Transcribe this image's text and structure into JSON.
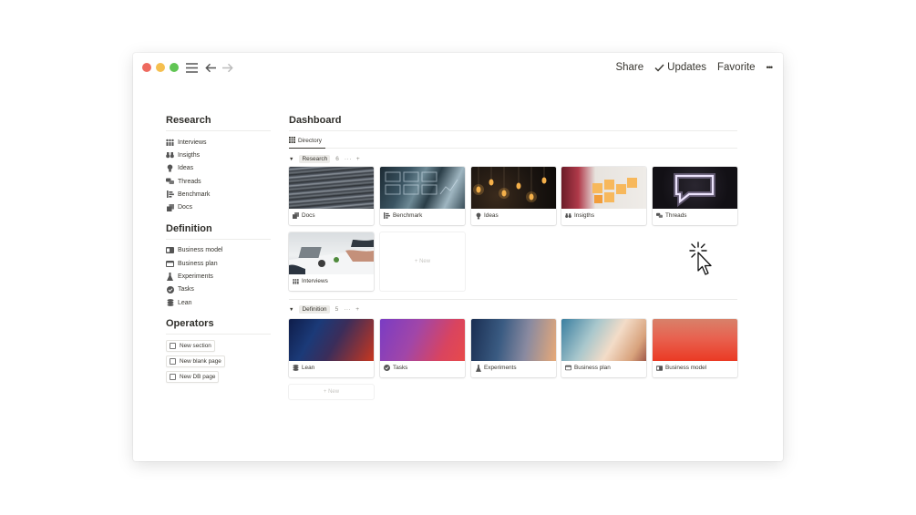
{
  "topbar": {
    "share": "Share",
    "updates": "Updates",
    "favorite": "Favorite",
    "more": "•••"
  },
  "sidebar": {
    "sections": [
      {
        "heading": "Research",
        "items": [
          {
            "label": "Interviews",
            "icon": "people-icon"
          },
          {
            "label": "Insigths",
            "icon": "binoculars-icon"
          },
          {
            "label": "Ideas",
            "icon": "lightbulb-icon"
          },
          {
            "label": "Threads",
            "icon": "chat-bubbles-icon"
          },
          {
            "label": "Benchmark",
            "icon": "bars-icon"
          },
          {
            "label": "Docs",
            "icon": "documents-icon"
          }
        ]
      },
      {
        "heading": "Definition",
        "items": [
          {
            "label": "Business model",
            "icon": "id-card-icon"
          },
          {
            "label": "Business plan",
            "icon": "window-icon"
          },
          {
            "label": "Experiments",
            "icon": "flask-icon"
          },
          {
            "label": "Tasks",
            "icon": "check-circle-icon"
          },
          {
            "label": "Lean",
            "icon": "layers-icon"
          }
        ]
      }
    ],
    "operators": {
      "heading": "Operators",
      "buttons": [
        "New section",
        "New blank page",
        "New DB page"
      ]
    }
  },
  "main": {
    "title": "Dashboard",
    "view_tab": "Directory",
    "groups": [
      {
        "name": "Research",
        "count": "6",
        "more": "···",
        "add": "+",
        "cards": [
          {
            "label": "Docs",
            "icon": "documents-icon",
            "cover": "sheet-waves"
          },
          {
            "label": "Benchmark",
            "icon": "bars-icon",
            "cover": "dashboard-screens"
          },
          {
            "label": "Ideas",
            "icon": "lightbulb-icon",
            "cover": "hanging-bulbs"
          },
          {
            "label": "Insigths",
            "icon": "binoculars-icon",
            "cover": "sticky-notes"
          },
          {
            "label": "Threads",
            "icon": "chat-bubbles-icon",
            "cover": "neon-bubble"
          },
          {
            "label": "Interviews",
            "icon": "people-icon",
            "cover": "meeting-table"
          }
        ],
        "new_label": "+ New"
      },
      {
        "name": "Definition",
        "count": "5",
        "more": "···",
        "add": "+",
        "cards": [
          {
            "label": "Lean",
            "icon": "layers-icon",
            "cover": "gradient-blue-red"
          },
          {
            "label": "Tasks",
            "icon": "check-circle-icon",
            "cover": "gradient-purple-pink"
          },
          {
            "label": "Experiments",
            "icon": "flask-icon",
            "cover": "gradient-navy-peach"
          },
          {
            "label": "Business plan",
            "icon": "window-icon",
            "cover": "gradient-teal-cream"
          },
          {
            "label": "Business model",
            "icon": "id-card-icon",
            "cover": "gradient-coral-red"
          }
        ],
        "new_label": "+ New"
      }
    ]
  }
}
